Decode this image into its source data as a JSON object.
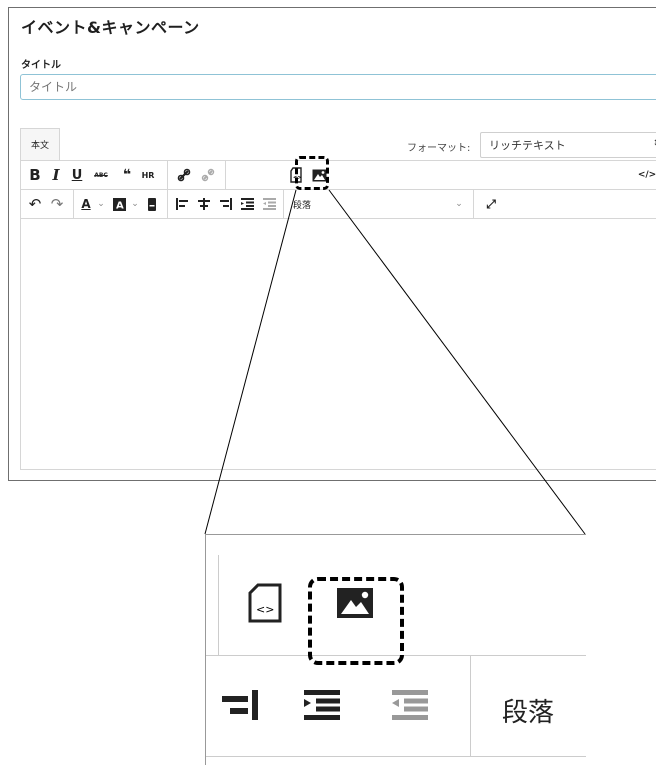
{
  "panel": {
    "title": "イベント&キャンペーン",
    "title_field_label": "タイトル",
    "title_placeholder": "タイトル"
  },
  "editor": {
    "tab_label": "本文",
    "format_label": "フォーマット:",
    "format_value": "リッチテキスト",
    "toolbar_row1": [
      {
        "name": "bold-button",
        "label": "B"
      },
      {
        "name": "italic-button",
        "label": "I"
      },
      {
        "name": "underline-button",
        "label": "U"
      },
      {
        "name": "strikethrough-button",
        "label": "ABC"
      },
      {
        "name": "blockquote-button",
        "label": "❝"
      },
      {
        "name": "horizontal-rule-button",
        "label": "HR"
      },
      {
        "name": "link-button",
        "label": "link"
      },
      {
        "name": "unlink-button",
        "label": "unlink"
      },
      {
        "name": "insert-media-button",
        "label": "media"
      },
      {
        "name": "insert-image-button",
        "label": "image"
      },
      {
        "name": "code-view-button",
        "label": "</>"
      }
    ],
    "paragraph_select": "段落"
  },
  "zoom": {
    "paragraph_label": "段落"
  },
  "colors": {
    "highlight": "#000000",
    "input_border": "#8fc3d6",
    "border": "#d6d6d6"
  }
}
